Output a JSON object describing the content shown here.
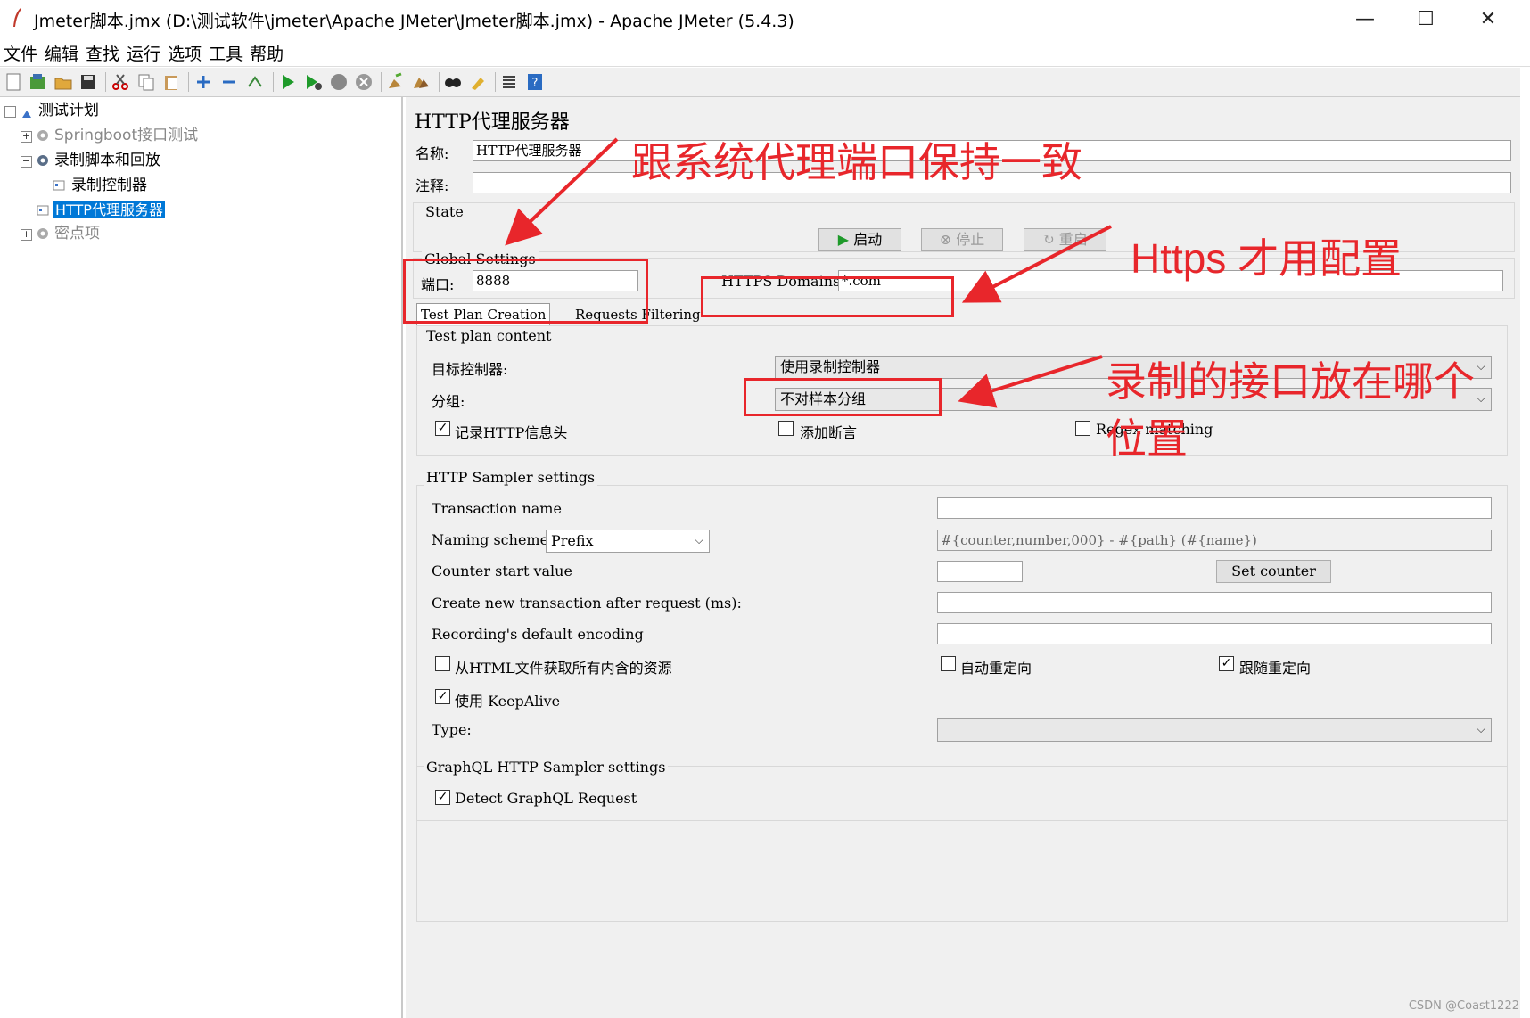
{
  "window": {
    "title": "Jmeter脚本.jmx (D:\\测试软件\\jmeter\\Apache JMeter\\Jmeter脚本.jmx) - Apache JMeter (5.4.3)",
    "minimize": "—",
    "maximize": "☐",
    "close": "✕"
  },
  "menu": [
    "文件",
    "编辑",
    "查找",
    "运行",
    "选项",
    "工具",
    "帮助"
  ],
  "tree": {
    "root": "测试计划",
    "items": [
      {
        "label": "Springboot接口测试",
        "disabled": true
      },
      {
        "label": "录制脚本和回放",
        "disabled": false
      },
      {
        "label": "录制控制器",
        "disabled": false
      },
      {
        "label": "HTTP代理服务器",
        "disabled": false,
        "selected": true
      },
      {
        "label": "密点项",
        "disabled": true
      }
    ]
  },
  "panel": {
    "heading": "HTTP代理服务器",
    "name_label": "名称:",
    "name_value": "HTTP代理服务器",
    "comment_label": "注释:",
    "comment_value": "",
    "state_label": "State",
    "start_btn": "启动",
    "stop_btn": "停止",
    "restart_btn": "重启",
    "global_label": "Global Settings",
    "port_label": "端口:",
    "port_value": "8888",
    "https_label": "HTTPS Domains:",
    "https_value": "*.com",
    "tabs": [
      "Test Plan Creation",
      "Requests Filtering"
    ],
    "plan_content_label": "Test plan content",
    "target_label": "目标控制器:",
    "target_value": "使用录制控制器",
    "group_label": "分组:",
    "group_value": "不对样本分组",
    "chk_headers": "记录HTTP信息头",
    "chk_assert": "添加断言",
    "chk_regex": "Regex matching",
    "sampler_label": "HTTP Sampler settings",
    "txn_label": "Transaction name",
    "txn_value": "",
    "naming_label": "Naming scheme",
    "naming_value": "Prefix",
    "naming_format": "#{counter,number,000} - #{path} (#{name})",
    "counter_label": "Counter start value",
    "counter_value": "",
    "set_counter": "Set counter",
    "create_txn_label": "Create new transaction after request (ms):",
    "encoding_label": "Recording's default encoding",
    "chk_resources": "从HTML文件获取所有内含的资源",
    "chk_autoredirect": "自动重定向",
    "chk_follow": "跟随重定向",
    "chk_keepalive": "使用 KeepAlive",
    "type_label": "Type:",
    "type_value": "",
    "graphql_label": "GraphQL HTTP Sampler settings",
    "chk_graphql": "Detect GraphQL Request"
  },
  "checks": {
    "headers": true,
    "assert": false,
    "regex": false,
    "resources": false,
    "autoredirect": false,
    "follow": true,
    "keepalive": true,
    "graphql": true
  },
  "annotations": {
    "a1": "跟系统代理端口保持一致",
    "a2": "Https 才用配置",
    "a3_line1": "录制的接口放在哪个",
    "a3_line2": "位置"
  },
  "watermark": "CSDN @Coast1222",
  "colors": {
    "annotation": "#e8262b",
    "selection": "#0078d7"
  }
}
